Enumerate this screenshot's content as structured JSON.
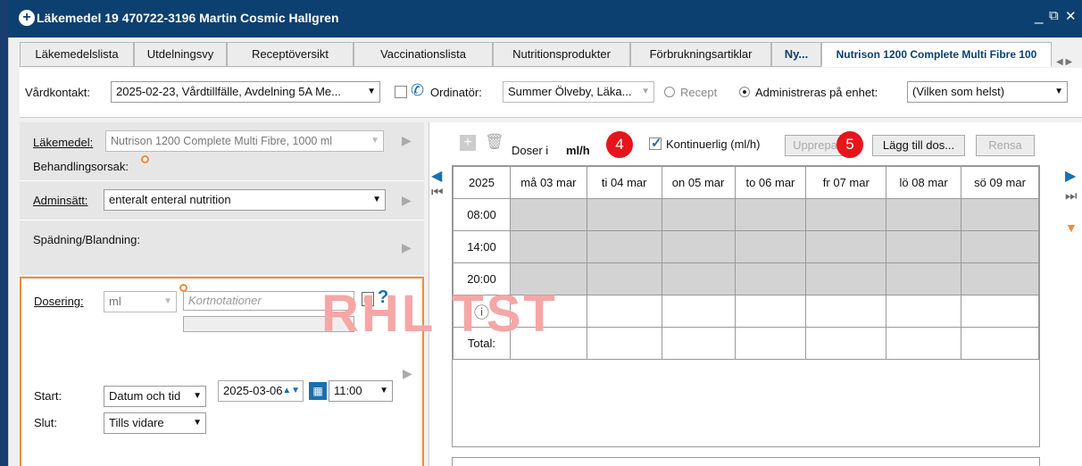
{
  "window": {
    "title": "Läkemedel 19 470722-3196 Martin Cosmic Hallgren",
    "minimize": "_",
    "restore": "⧉",
    "close": "✕"
  },
  "tabs": [
    "Läkemedelslista",
    "Utdelningsvy",
    "Receptöversikt",
    "Vaccinationslista",
    "Nutritionsprodukter",
    "Förbrukningsartiklar",
    "Ny...",
    "Nutrison 1200  Complete Multi Fibre 100"
  ],
  "toolbar": {
    "vardkontakt_label": "Vårdkontakt:",
    "vardkontakt_value": "2025-02-23, Vårdtillfälle, Avdelning 5A Me...",
    "ordinator_label": "Ordinatör:",
    "ordinator_value": "Summer Ölveby, Läka...",
    "recept_label": "Recept",
    "administreras_label": "Administreras på enhet:",
    "enhet_value": "(Vilken som helst)"
  },
  "left": {
    "lakemedel_label": "Läkemedel:",
    "lakemedel_value": "Nutrison 1200  Complete Multi Fibre, 1000 ml",
    "behandlingsorsak_label": "Behandlingsorsak:",
    "adminsatt_label": "Adminsätt:",
    "adminsatt_value": "enteralt enteral nutrition",
    "spadning_label": "Spädning/Blandning:",
    "dosering_label": "Dosering:",
    "dosering_unit": "ml",
    "kortnotationer_placeholder": "Kortnotationer",
    "start_label": "Start:",
    "start_type": "Datum och tid",
    "start_date": "2025-03-06",
    "start_time": "11:00",
    "slut_label": "Slut:",
    "slut_value": "Tills vidare"
  },
  "right": {
    "doser_i_label": "Doser i",
    "doser_unit": "ml/h",
    "kontinuerlig_label": "Kontinuerlig (ml/h)",
    "upprepa_label": "Upprepa",
    "lagg_till_label": "Lägg till dos...",
    "rensa_label": "Rensa",
    "badge4": "4",
    "badge5": "5"
  },
  "calendar": {
    "year": "2025",
    "days": [
      "må 03 mar",
      "ti 04 mar",
      "on 05 mar",
      "to 06 mar",
      "fr 07 mar",
      "lö 08 mar",
      "sö 09 mar"
    ],
    "times": [
      "08:00",
      "14:00",
      "20:00"
    ],
    "info_icon": "ⓘ",
    "total_label": "Total:"
  },
  "watermark": "RHL TST",
  "colors": {
    "title_bg": "#0c4070",
    "accent_blue": "#1a6fb0",
    "badge_red": "#e8141b",
    "orange": "#f08c3a"
  }
}
